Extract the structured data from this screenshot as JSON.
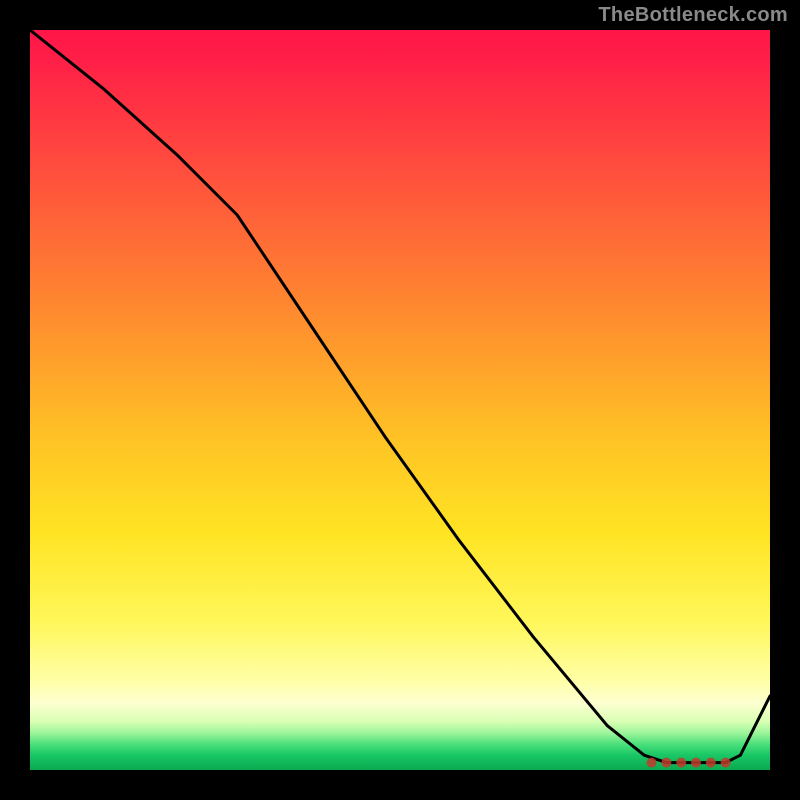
{
  "watermark": "TheBottleneck.com",
  "chart_data": {
    "type": "line",
    "title": "",
    "xlabel": "",
    "ylabel": "",
    "xlim": [
      0,
      100
    ],
    "ylim": [
      0,
      100
    ],
    "series": [
      {
        "name": "curve",
        "x": [
          0,
          10,
          20,
          28,
          38,
          48,
          58,
          68,
          78,
          83,
          86,
          89,
          92,
          94,
          96,
          100
        ],
        "y": [
          100,
          92,
          83,
          75,
          60,
          45,
          31,
          18,
          6,
          2,
          1,
          1,
          1,
          1,
          2,
          10
        ]
      }
    ],
    "markers": {
      "name": "valley-dots",
      "x": [
        84,
        86,
        88,
        90,
        92,
        94
      ],
      "y": [
        1,
        1,
        1,
        1,
        1,
        1
      ]
    },
    "colors": {
      "line": "#000000",
      "markers": "#c0392b"
    }
  }
}
